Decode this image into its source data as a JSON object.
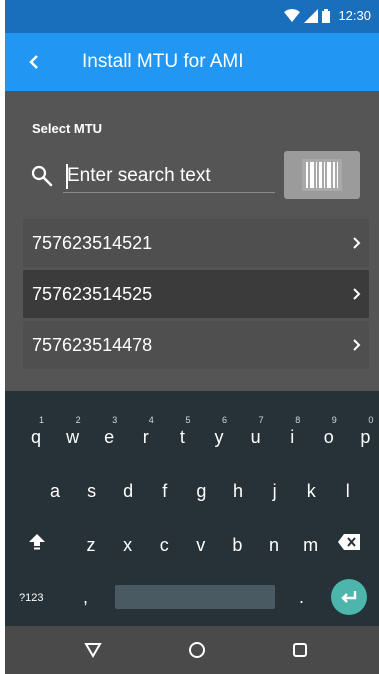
{
  "status_bar": {
    "time": "12:30",
    "icons": [
      "wifi-icon",
      "signal-icon",
      "battery-icon"
    ]
  },
  "app_bar": {
    "title": "Install MTU for AMI",
    "back_icon": "chevron-left-icon"
  },
  "main": {
    "section_label": "Select MTU",
    "search": {
      "placeholder": "Enter search text",
      "value": ""
    },
    "scan_button_icon": "barcode-icon",
    "mtu_items": [
      {
        "label": "757623514521",
        "selected": false
      },
      {
        "label": "757623514525",
        "selected": true
      },
      {
        "label": "757623514478",
        "selected": false
      }
    ]
  },
  "keyboard": {
    "row1": [
      {
        "key": "q",
        "hint": "1"
      },
      {
        "key": "w",
        "hint": "2"
      },
      {
        "key": "e",
        "hint": "3"
      },
      {
        "key": "r",
        "hint": "4"
      },
      {
        "key": "t",
        "hint": "5"
      },
      {
        "key": "y",
        "hint": "6"
      },
      {
        "key": "u",
        "hint": "7"
      },
      {
        "key": "i",
        "hint": "8"
      },
      {
        "key": "o",
        "hint": "9"
      },
      {
        "key": "p",
        "hint": "0"
      }
    ],
    "row2": [
      "a",
      "s",
      "d",
      "f",
      "g",
      "h",
      "j",
      "k",
      "l"
    ],
    "row3": [
      "z",
      "x",
      "c",
      "v",
      "b",
      "n",
      "m"
    ],
    "symbols_label": "?123",
    "comma": ",",
    "period": ".",
    "shift_icon": "shift-icon",
    "backspace_icon": "backspace-icon",
    "enter_icon": "enter-icon"
  },
  "nav_bar": {
    "icons": [
      "back-triangle-icon",
      "home-circle-icon",
      "recents-square-icon"
    ]
  },
  "colors": {
    "status_bar": "#1a6fbd",
    "app_bar": "#2196f3",
    "content_bg": "#555555",
    "keyboard_bg": "#263238",
    "enter_key": "#4db6ac"
  }
}
